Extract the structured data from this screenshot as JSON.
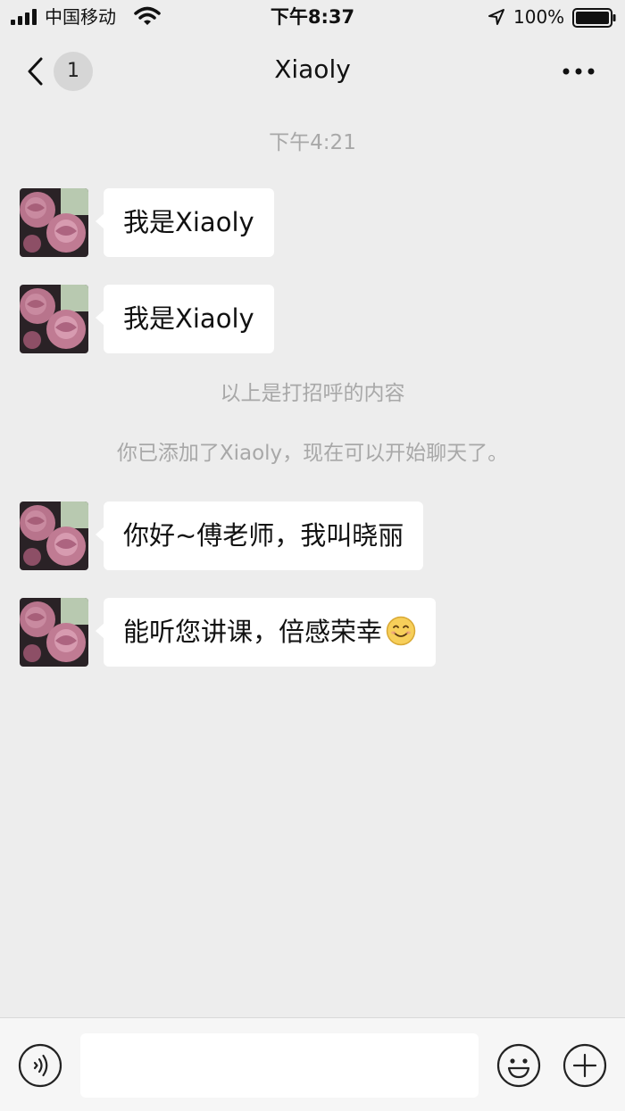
{
  "status_bar": {
    "carrier": "中国移动",
    "time": "下午8:37",
    "battery_percent": "100%",
    "icons": [
      "signal-icon",
      "wifi-icon",
      "location-arrow-icon",
      "battery-icon"
    ]
  },
  "nav": {
    "title": "Xiaoly",
    "unread_count": "1",
    "icons": [
      "chevron-left-icon",
      "more-icon"
    ]
  },
  "chat": {
    "timestamp": "下午4:21",
    "greeting_divider": "以上是打招呼的内容",
    "added_notice": "你已添加了Xiaoly，现在可以开始聊天了。",
    "messages": [
      {
        "text": "我是Xiaoly"
      },
      {
        "text": "我是Xiaoly"
      },
      {
        "text": "你好~傅老师，我叫晓丽"
      },
      {
        "text": "能听您讲课，倍感荣幸",
        "trailing_emoji": "smile-emoji"
      }
    ]
  },
  "input_bar": {
    "value": "",
    "placeholder": "",
    "icons": [
      "voice-icon",
      "emoji-icon",
      "plus-icon"
    ]
  },
  "colors": {
    "background": "#ededed",
    "bubble": "#ffffff",
    "system_text": "#a8a8a8",
    "input_bar": "#f6f6f6"
  }
}
